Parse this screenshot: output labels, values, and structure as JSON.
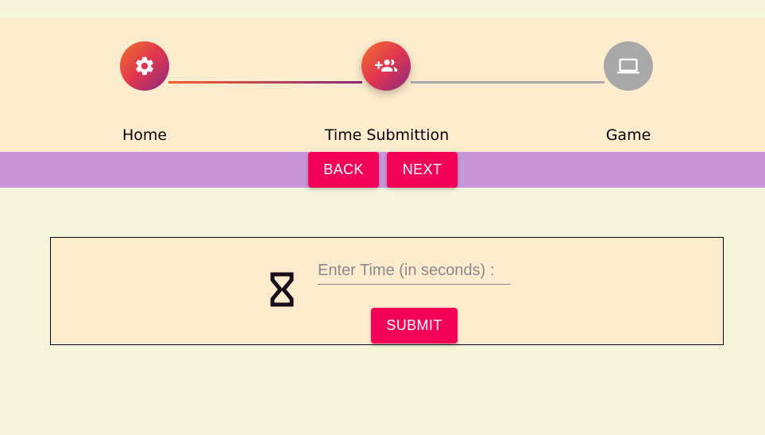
{
  "stepper": {
    "steps": [
      {
        "label": "Home",
        "icon": "gear-icon",
        "state": "completed"
      },
      {
        "label": "Time Submittion",
        "icon": "add-group-icon",
        "state": "active"
      },
      {
        "label": "Game",
        "icon": "laptop-icon",
        "state": "inactive"
      }
    ]
  },
  "nav": {
    "back_label": "BACK",
    "next_label": "NEXT"
  },
  "time_form": {
    "icon": "hourglass-icon",
    "input_value": "",
    "input_placeholder": "Enter Time (in seconds) :",
    "submit_label": "SUBMIT"
  },
  "colors": {
    "page_background": "#f5f5dc",
    "panel_background": "#ffebcd",
    "nav_background": "#c896d8",
    "accent": "#f50057",
    "step_gradient_start": "#f2712a",
    "step_gradient_end": "#8c2a80",
    "inactive": "#a8a8a8"
  }
}
